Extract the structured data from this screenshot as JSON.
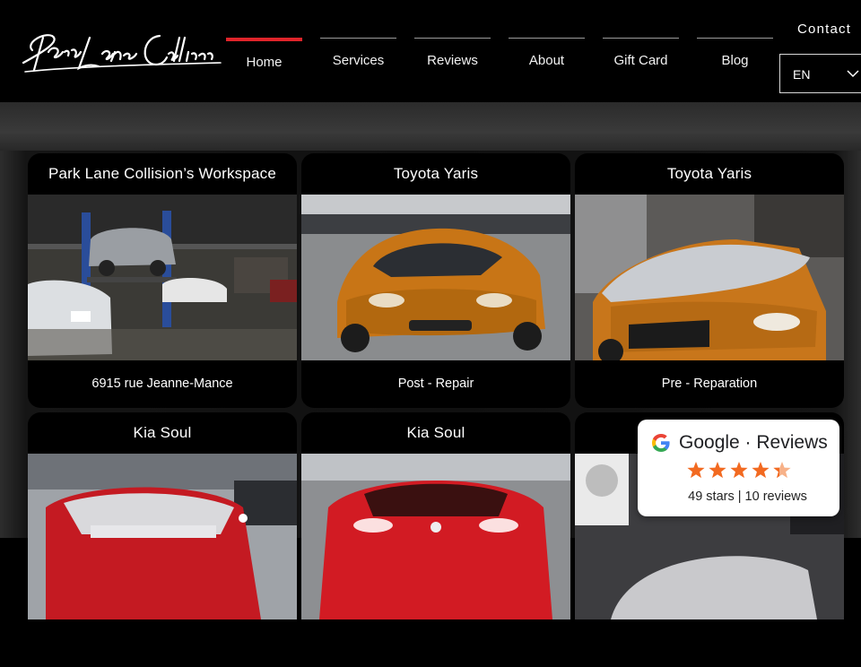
{
  "brand": {
    "name": "Park Lane Collision"
  },
  "nav": {
    "items": [
      {
        "label": "Home",
        "active": true
      },
      {
        "label": "Services",
        "active": false
      },
      {
        "label": "Reviews",
        "active": false
      },
      {
        "label": "About",
        "active": false
      },
      {
        "label": "Gift Card",
        "active": false
      },
      {
        "label": "Blog",
        "active": false
      }
    ],
    "contact_label": "Contact",
    "language": "EN"
  },
  "gallery": {
    "cards": [
      {
        "title": "Park Lane Collision’s Workspace",
        "caption": "6915 rue Jeanne-Mance",
        "photo": "garage-workspace-photo"
      },
      {
        "title": "Toyota Yaris",
        "caption": "Post - Repair",
        "photo": "orange-car-repaired-photo"
      },
      {
        "title": "Toyota Yaris",
        "caption": "Pre - Reparation",
        "photo": "orange-car-damaged-photo"
      },
      {
        "title": "Kia Soul",
        "caption": "",
        "photo": "red-car-damaged-photo"
      },
      {
        "title": "Kia Soul",
        "caption": "",
        "photo": "red-car-repaired-photo"
      },
      {
        "title": "",
        "caption": "",
        "photo": "shop-interior-photo"
      }
    ]
  },
  "google_widget": {
    "brand": "Google",
    "separator": " · ",
    "label": "Reviews",
    "rating": 4.9,
    "summary": "49 stars | 10 reviews",
    "star_color": "#f26a21"
  },
  "colors": {
    "accent": "#e0242a",
    "background": "#000000"
  }
}
